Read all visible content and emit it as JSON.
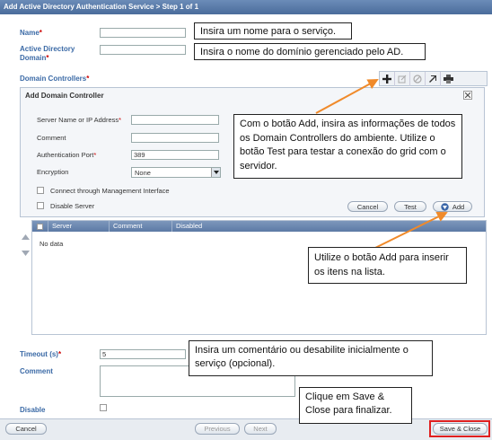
{
  "window": {
    "title": "Add Active Directory Authentication Service > Step 1 of 1"
  },
  "form": {
    "name_label": "Name",
    "ad_domain_label_1": "Active Directory",
    "ad_domain_label_2": "Domain",
    "required_mark": "*",
    "domain_controllers_label": "Domain Controllers",
    "timeout_label": "Timeout (s)",
    "timeout_value": "5",
    "comment_label": "Comment",
    "disable_label": "Disable"
  },
  "dialog": {
    "title": "Add Domain Controller",
    "server_label": "Server Name or IP Address",
    "comment_label": "Comment",
    "port_label": "Authentication Port",
    "port_value": "389",
    "encryption_label": "Encryption",
    "encryption_value": "None",
    "mgmt_label": "Connect through Management Interface",
    "disable_server_label": "Disable Server",
    "cancel_label": "Cancel",
    "test_label": "Test",
    "add_label": "Add"
  },
  "grid": {
    "columns": [
      "Server",
      "Comment",
      "Disabled"
    ],
    "empty_text": "No data"
  },
  "footer": {
    "cancel_label": "Cancel",
    "previous_label": "Previous",
    "next_label": "Next",
    "save_label": "Save & Close"
  },
  "callouts": {
    "name": "Insira um nome para o serviço.",
    "domain": "Insira o nome do domínio gerenciado pelo AD.",
    "add_dc": "Com o botão Add, insira as informações de todos os Domain Controllers do ambiente. Utilize o botão Test para testar a conexão do grid com o servidor.",
    "add_list": "Utilize o botão Add para inserir os itens na lista.",
    "comment": "Insira um comentário ou desabilite inicialmente o serviço (opcional).",
    "save": "Clique em Save & Close para finalizar."
  },
  "colors": {
    "accent": "#f08a2a",
    "title_bar": "#5577a5",
    "label_blue": "#3b6aa6",
    "save_highlight": "#e02020"
  },
  "icons": [
    "plus-icon",
    "edit-icon",
    "disable-icon",
    "arrow-icon",
    "print-icon",
    "close-icon",
    "arrow-up-icon",
    "arrow-down-icon",
    "add-arrow-icon",
    "dropdown-icon"
  ]
}
